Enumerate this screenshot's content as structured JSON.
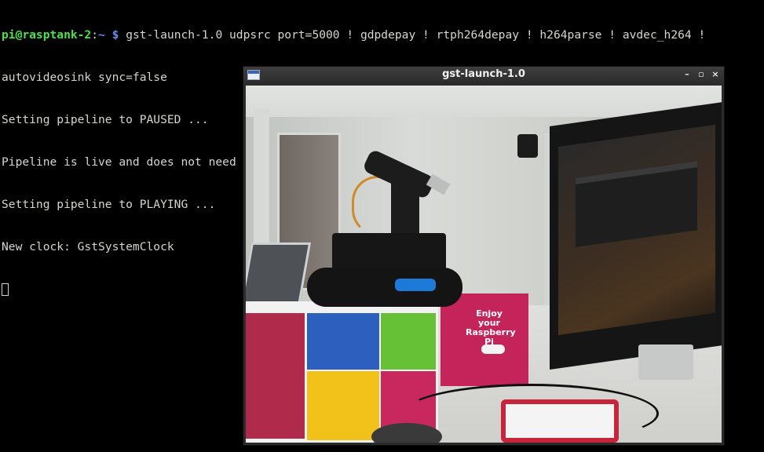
{
  "terminal": {
    "prompt_user": "pi@rasptank-2",
    "prompt_sep": ":",
    "prompt_path": "~",
    "prompt_sign": "$",
    "command": "gst-launch-1.0 udpsrc port=5000 ! gdpdepay ! rtph264depay ! h264parse ! avdec_h264 !",
    "lines": [
      "autovideosink sync=false",
      "Setting pipeline to PAUSED ...",
      "Pipeline is live and does not need PREROLL ...",
      "Setting pipeline to PLAYING ...",
      "New clock: GstSystemClock"
    ]
  },
  "window": {
    "title": "gst-launch-1.0",
    "minimize_glyph": "–",
    "maximize_glyph": "▫",
    "close_glyph": "×",
    "icon": "window-app-icon"
  },
  "video": {
    "box_right_text": "Enjoy your Raspberry Pi"
  },
  "colors": {
    "background": "#000000",
    "text": "#d3d7cf",
    "prompt_user": "#4ae24a",
    "prompt_path": "#6b8cf0",
    "titlebar": "#2c2c2c"
  }
}
